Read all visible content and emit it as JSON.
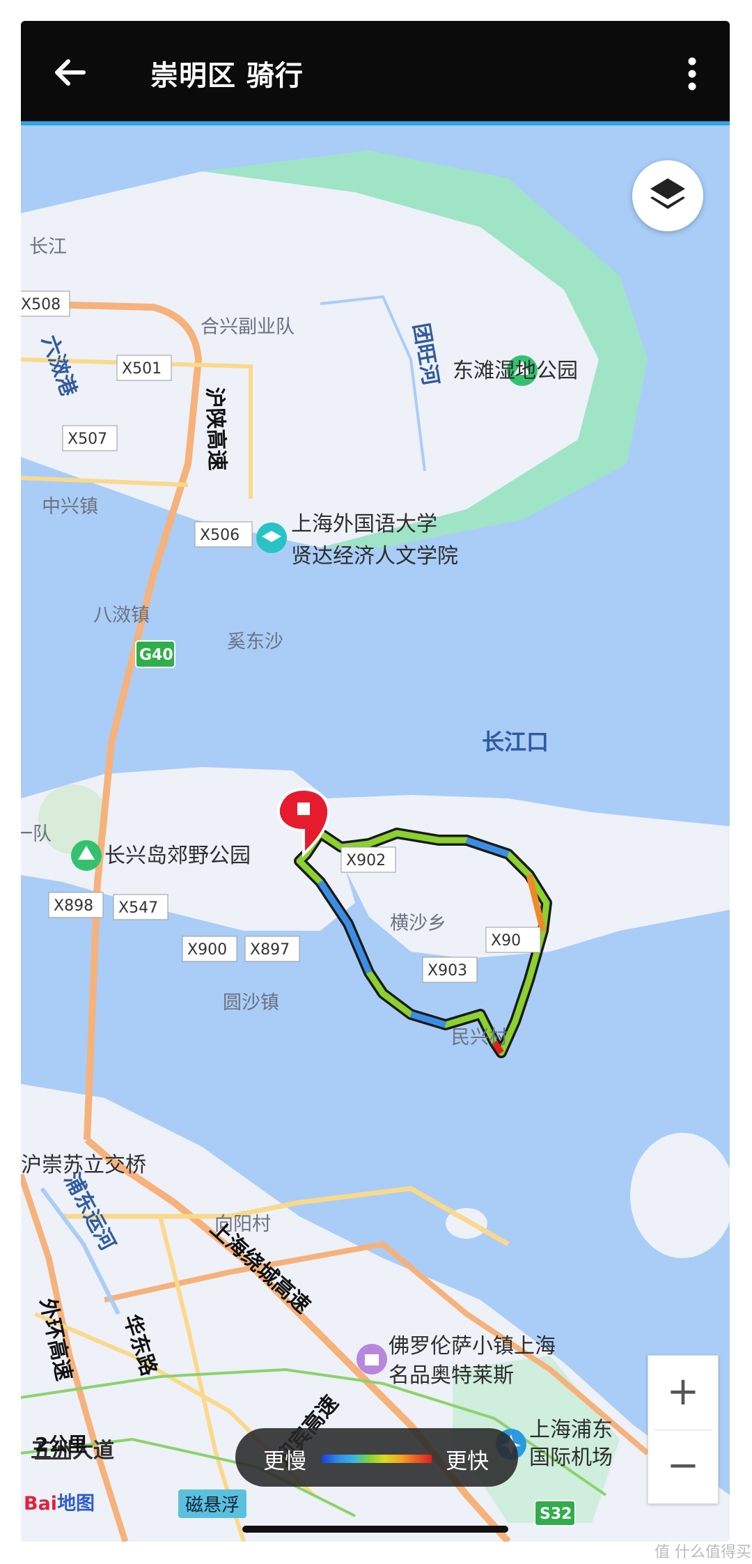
{
  "header": {
    "title": "崇明区 骑行"
  },
  "map": {
    "places": {
      "changjiang": "长江",
      "hexing": "合兴副业队",
      "dongtan": "东滩湿地公园",
      "tuanwang": "团旺河",
      "zhongxing": "中兴镇",
      "university": "上海外国语大学",
      "college": "贤达经济人文学院",
      "baxiao": "八滧镇",
      "xidong": "奚东沙",
      "changjiangkou": "长江口",
      "dui": "一队",
      "changxing_park": "长兴岛郊野公园",
      "hengsha": "横沙乡",
      "yuansha": "圆沙镇",
      "minxing": "民兴村",
      "xiangyang": "向阳村",
      "florentia": "佛罗伦萨小镇上海",
      "outlets": "名品奥特莱斯",
      "pudong_airport": "上海浦东",
      "airport": "国际机场",
      "huju": "沪崇苏立交桥",
      "wuzhou": "五洲大道",
      "pudong_canal": "浦东运河",
      "liuxiao": "六滧港",
      "huashan": "华东路"
    },
    "roads": {
      "husha": "沪陕高速",
      "raocheng": "上海绕城高速",
      "waihuan": "外环高速",
      "yingbin": "迎宾高速"
    },
    "shields": {
      "x508": "X508",
      "x501": "X501",
      "x507": "X507",
      "x506": "X506",
      "g40": "G40",
      "x898": "X898",
      "x547": "X547",
      "x900": "X900",
      "x897": "X897",
      "x903": "X903",
      "x902": "X902",
      "x901": "X90",
      "s32": "S32"
    },
    "route_color_scale": [
      "#1c3fd6",
      "#2b8ae6",
      "#7ed13a",
      "#d8dc21",
      "#f5a623",
      "#e0201c"
    ]
  },
  "legend": {
    "slow": "更慢",
    "fast": "更快"
  },
  "scale": {
    "label": "2公里"
  },
  "brand": {
    "baidu": "Bai",
    "baidu_map": "地图",
    "maglev": "磁悬浮"
  },
  "watermark": "值 什么值得买"
}
